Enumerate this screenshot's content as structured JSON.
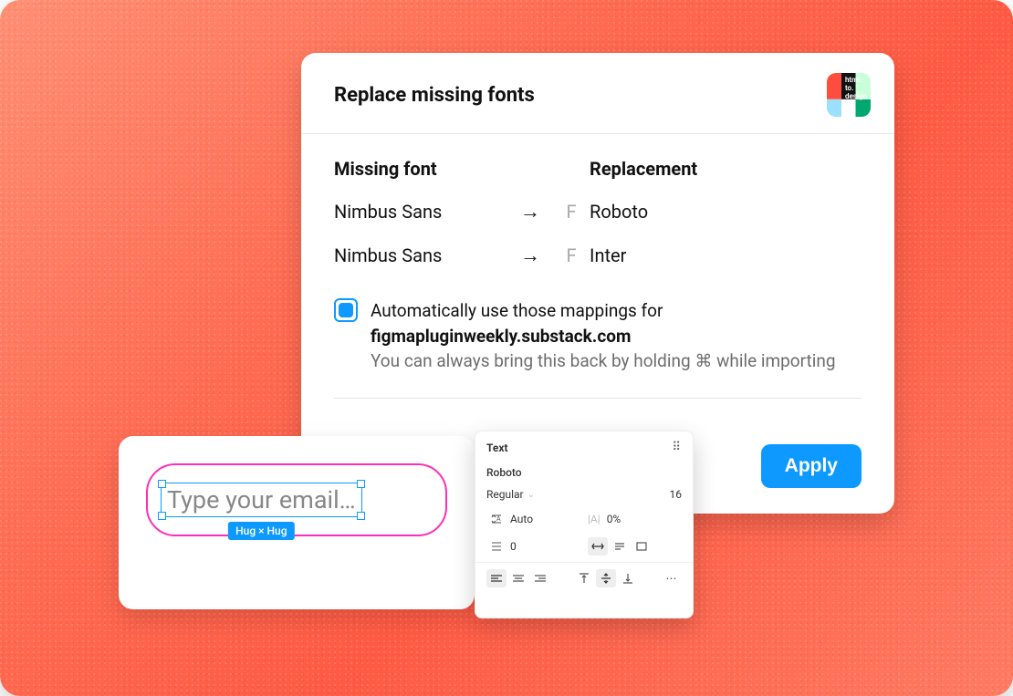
{
  "modal": {
    "title": "Replace missing fonts",
    "plugin_name": "html.to.design",
    "col_missing": "Missing font",
    "col_replacement": "Replacement",
    "arrow_glyph": "→",
    "family_mark": "F",
    "mappings": [
      {
        "missing": "Nimbus Sans",
        "replacement": "Roboto"
      },
      {
        "missing": "Nimbus Sans",
        "replacement": "Inter"
      }
    ],
    "auto_use_label": "Automatically use those mappings for",
    "auto_use_domain": "figmapluginweekly.substack.com",
    "auto_use_hint": "You can always bring this back by holding ⌘ while importing",
    "apply_label": "Apply"
  },
  "canvas_node": {
    "placeholder_text": "Type your email…",
    "size_tag": "Hug × Hug"
  },
  "panel": {
    "title": "Text",
    "font": "Roboto",
    "weight": "Regular",
    "size": "16",
    "line_height": "Auto",
    "letter_spacing": "0%",
    "paragraph_spacing": "0"
  }
}
